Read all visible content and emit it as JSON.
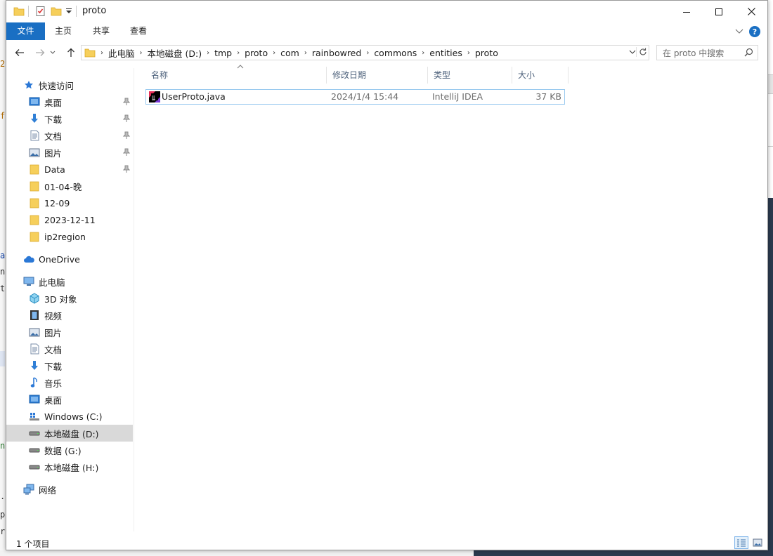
{
  "window": {
    "title": "proto",
    "controls": {
      "minimize": "—",
      "maximize": "☐",
      "close": "✕"
    }
  },
  "ribbon": {
    "tabs": [
      "文件",
      "主页",
      "共享",
      "查看"
    ],
    "help": "?"
  },
  "address": {
    "breadcrumbs": [
      "此电脑",
      "本地磁盘 (D:)",
      "tmp",
      "proto",
      "com",
      "rainbowred",
      "commons",
      "entities",
      "proto"
    ]
  },
  "search": {
    "placeholder": "在 proto 中搜索"
  },
  "sidebar": {
    "quick_access": "快速访问",
    "quick_items": [
      "桌面",
      "下载",
      "文档",
      "图片",
      "Data",
      "01-04-晚",
      "12-09",
      "2023-12-11",
      "ip2region"
    ],
    "onedrive": "OneDrive",
    "this_pc": "此电脑",
    "pc_items": [
      "3D 对象",
      "视频",
      "图片",
      "文档",
      "下载",
      "音乐",
      "桌面",
      "Windows (C:)",
      "本地磁盘 (D:)",
      "数据 (G:)",
      "本地磁盘 (H:)"
    ],
    "network": "网络"
  },
  "columns": {
    "name": "名称",
    "modified": "修改日期",
    "type": "类型",
    "size": "大小"
  },
  "files": [
    {
      "name": "UserProto.java",
      "modified": "2024/1/4 15:44",
      "type": "IntelliJ IDEA",
      "size": "37 KB"
    }
  ],
  "status": {
    "count": "1 个项目"
  },
  "background_glyphs": [
    "2",
    "f",
    "a",
    "n",
    "t",
    "n",
    ".",
    "p",
    "r"
  ],
  "colors": {
    "accent": "#1a6fc3",
    "folder": "#f6cf5b",
    "selected": "#d9d9d9"
  }
}
